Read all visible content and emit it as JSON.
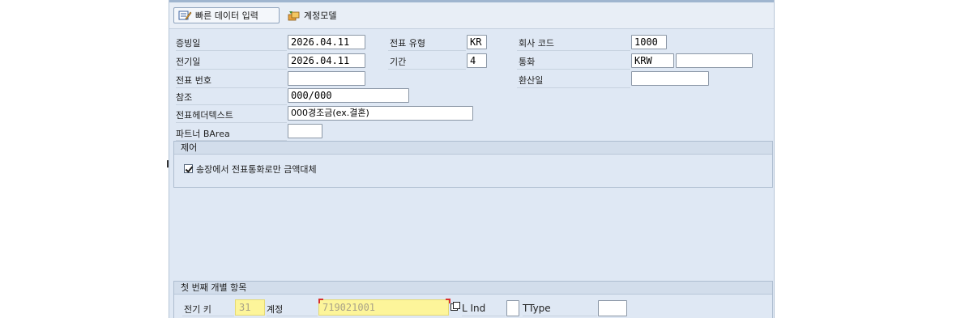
{
  "toolbar": {
    "quick_entry_label": "빠른 데이터 입력",
    "account_model_label": "계정모델"
  },
  "header": {
    "doc_date": {
      "label": "증빙일",
      "value": "2026.04.11"
    },
    "posting_date": {
      "label": "전기일",
      "value": "2026.04.11"
    },
    "doc_number": {
      "label": "전표 번호",
      "value": ""
    },
    "reference": {
      "label": "참조",
      "value": "000/000"
    },
    "header_text": {
      "label": "전표헤더텍스트",
      "value": "000경조금(ex.결혼)"
    },
    "partner_barea": {
      "label": "파트너 BArea",
      "value": ""
    },
    "doc_type": {
      "label": "전표 유형",
      "value": "KR"
    },
    "period": {
      "label": "기간",
      "value": "4"
    },
    "company_code": {
      "label": "회사 코드",
      "value": "1000"
    },
    "currency": {
      "label": "통화",
      "value": "KRW",
      "extra_value": ""
    },
    "translation_date": {
      "label": "환산일",
      "value": ""
    }
  },
  "control": {
    "title": "제어",
    "checkbox_label": "송장에서 전표통화로만 금액대체",
    "checked": true
  },
  "first_item": {
    "title": "첫 번째 개별 항목",
    "posting_key_label": "전기 키",
    "posting_key_value": "31",
    "account_label": "계정",
    "account_value": "719021001",
    "sgl_ind_label": "L Ind",
    "sgl_ind_value": "",
    "ttype_label": "TType",
    "ttype_value": ""
  },
  "colors": {
    "background": "#dfe8f4",
    "field_border": "#8b97a6",
    "highlight": "#fdf59a",
    "error_mark": "#d9302c"
  }
}
